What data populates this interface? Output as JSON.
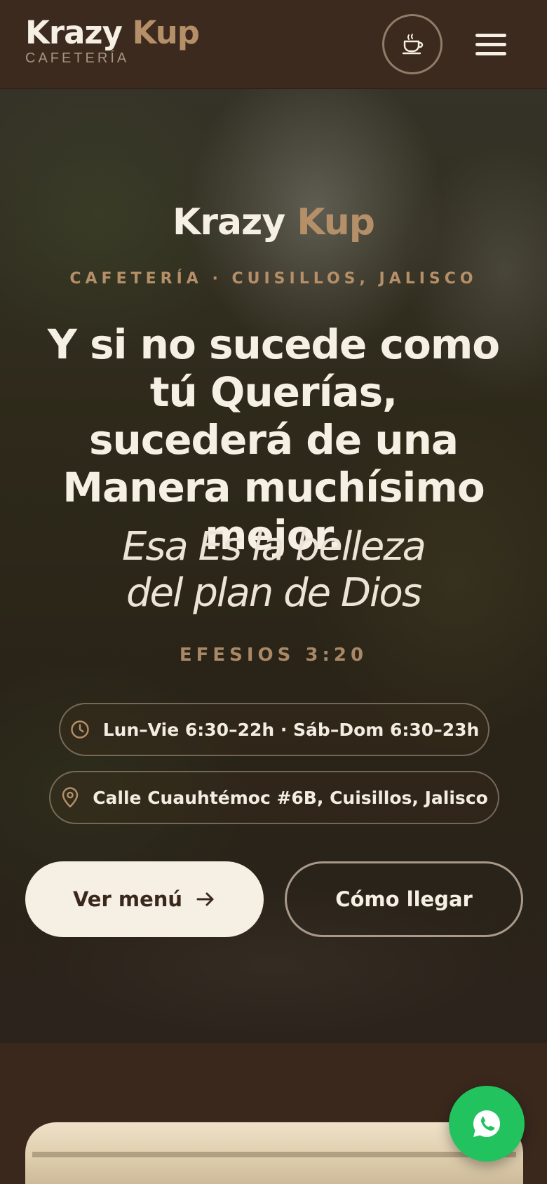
{
  "header": {
    "brand_first": "Krazy",
    "brand_second": "Kup",
    "brand_sub": "CAFETERÍA",
    "cup_icon": "coffee-cup-icon",
    "menu_icon": "hamburger-menu-icon"
  },
  "hero": {
    "brand_first": "Krazy",
    "brand_second": "Kup",
    "eyebrow": "CAFETERÍA · CUISILLOS, JALISCO",
    "title": "Y si no sucede como tú Querías, sucederá de una Manera muchísimo mejor.",
    "quote_line1": "Esa Es la belleza",
    "quote_line2": "del plan de Dios",
    "verse": "EFESIOS 3:20",
    "hours": "Lun–Vie 6:30–22h · Sáb–Dom 6:30–23h",
    "address": "Calle Cuauhtémoc #6B, Cuisillos, Jalisco",
    "menu_button": "Ver menú",
    "route_button": "Cómo llegar"
  },
  "colors": {
    "header_bg": "#3c2a1f",
    "accent": "#b58f68",
    "cream": "#f6efe3",
    "whatsapp": "#22c35e"
  },
  "floating": {
    "whatsapp_icon": "whatsapp-icon"
  }
}
